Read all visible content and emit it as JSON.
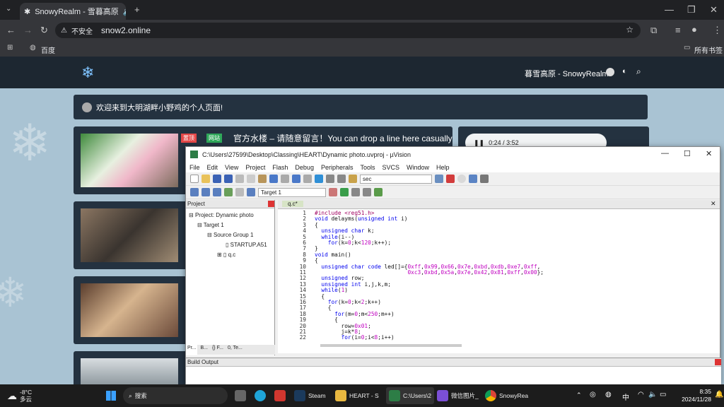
{
  "browser": {
    "tab_title": "SnowyRealm - 雪暮高原",
    "security_label": "不安全",
    "url": "snow2.online",
    "bookmark_1": "百度",
    "bookmarks_folder": "所有书签"
  },
  "site": {
    "brand": "暮雪高原 - SnowyRealm",
    "welcome": "欢迎来到大明湖畔小野鸡的个人页面!",
    "badge_pinned": "置顶",
    "badge_site": "网站",
    "post_title": "官方水楼 – 请随意留言！You can drop a line here casually",
    "player_time": "0:24 / 3:52"
  },
  "uvision": {
    "title": "C:\\Users\\27599\\Desktop\\Classing\\HEART\\Dynamic photo.uvproj - µVision",
    "menu": [
      "File",
      "Edit",
      "View",
      "Project",
      "Flash",
      "Debug",
      "Peripherals",
      "Tools",
      "SVCS",
      "Window",
      "Help"
    ],
    "search_value": "sec",
    "target": "Target 1",
    "project_pane_title": "Project",
    "tree": {
      "project": "Project: Dynamic photo",
      "target": "Target 1",
      "group": "Source Group 1",
      "file1": "STARTUP.A51",
      "file2": "q.c"
    },
    "pane_tabs": [
      "Pr...",
      "B...",
      "{} F...",
      "0, Te..."
    ],
    "editor_tab": "q.c*",
    "build_output": "Build Output",
    "code_lines": [
      "#include <reg51.h>",
      "void delayms(unsigned int i)",
      "{",
      "  unsigned char k;",
      "  while(i--)",
      "    for(k=0;k<120;k++);",
      "}",
      "void main()",
      "{",
      "  unsigned char code led[]={0xff,0x99,0x66,0x7e,0xbd,0xdb,0xe7,0xff,",
      "                            0xc3,0xbd,0x5a,0x7e,0x42,0x81,0xff,0x00};",
      "  unsigned row;",
      "  unsigned int i,j,k,m;",
      "  while(1)",
      "  {",
      "    for(k=0;k<2;k++)",
      "    {",
      "      for(m=0;m<250;m++)",
      "      {",
      "        row=0x01;",
      "        j=k*8;",
      "        for(i=0;i<8;i++)"
    ]
  },
  "taskbar": {
    "weather_temp": "-8°C",
    "weather_desc": "多云",
    "search_label": "搜索",
    "apps": [
      "Steam",
      "HEART - S",
      "C:\\Users\\2",
      "微信图片_",
      "SnowyRea"
    ],
    "ime": "中",
    "time": "8:35",
    "date": "2024/11/28"
  }
}
